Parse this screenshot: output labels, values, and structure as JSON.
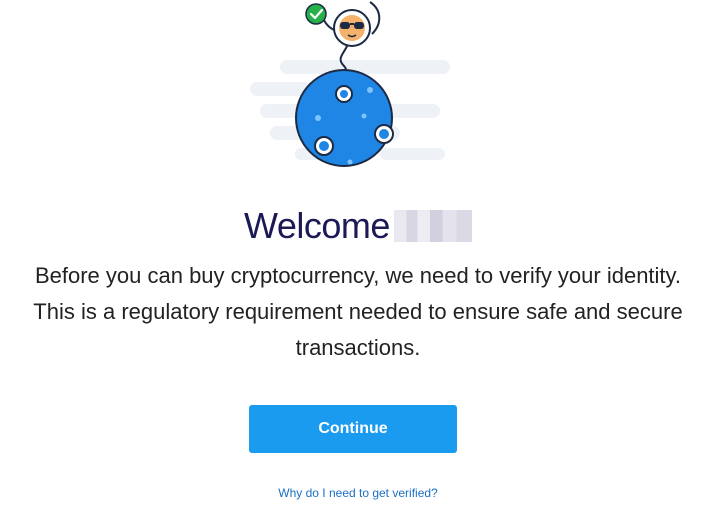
{
  "illustration": {
    "icon": "astronaut-on-planet-illustration",
    "badge_icon": "check-badge-icon",
    "colors": {
      "planet": "#1f86e6",
      "badge": "#26b04a",
      "cloud": "#eef1f5",
      "outline": "#1c2a44"
    }
  },
  "welcome": {
    "title": "Welcome"
  },
  "description": {
    "line1": "Before you can buy cryptocurrency, we need to verify your identity.",
    "line2": "This is a regulatory requirement needed to ensure safe and secure",
    "line3": "transactions."
  },
  "actions": {
    "continue_label": "Continue",
    "why_link": "Why do I need to get verified?"
  },
  "colors": {
    "primary": "#1b9bf0",
    "heading": "#1c1a55",
    "link": "#1b6fc4"
  }
}
